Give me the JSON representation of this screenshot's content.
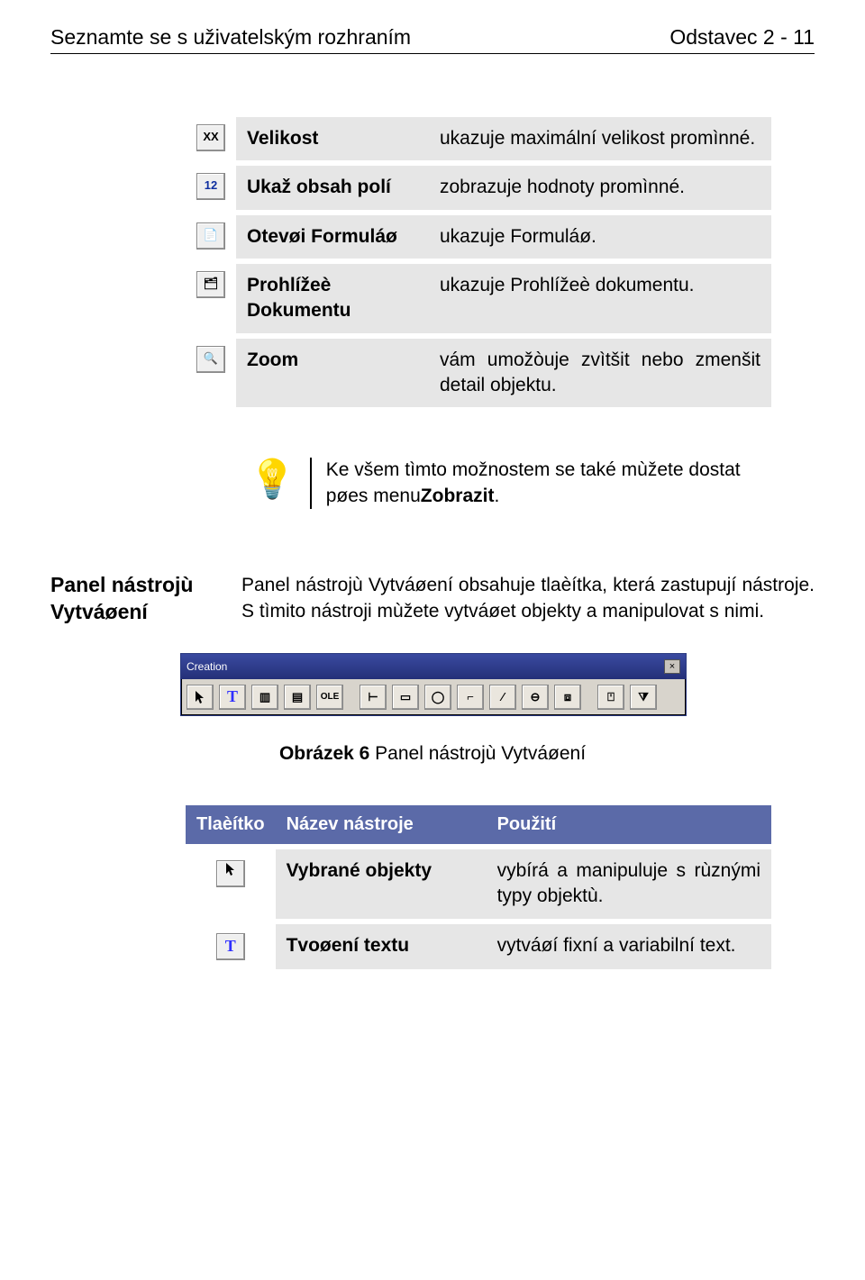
{
  "header": {
    "left": "Seznamte se s uživatelským rozhraním",
    "right": "Odstavec 2 - 11"
  },
  "table1": [
    {
      "icon": "xx-icon",
      "iconText": "XX",
      "name": "Velikost",
      "desc": "ukazuje maximální velikost promìnné."
    },
    {
      "icon": "number-icon",
      "iconText": "12",
      "name": "Ukaž obsah polí",
      "desc": "zobrazuje hodnoty promìnné."
    },
    {
      "icon": "form-icon",
      "iconText": "📄",
      "name": "Otevøi Formuláø",
      "desc": "ukazuje Formuláø."
    },
    {
      "icon": "tree-icon",
      "iconText": "🗂",
      "name": "Prohlížeè Dokumentu",
      "desc": "ukazuje Prohlížeè dokumentu."
    },
    {
      "icon": "zoom-icon",
      "iconText": "🔍",
      "name": "Zoom",
      "desc": "vám umožòuje zvìtšit nebo zmenšit detail objektu."
    }
  ],
  "tip": {
    "part1": "Ke všem tìmto možnostem se také mùžete dostat pøes menu",
    "bold": "Zobrazit",
    "part2": "."
  },
  "section": {
    "label": "Panel nástrojù Vytváøení",
    "body": "Panel nástrojù Vytváøení obsahuje tlaèítka, která zastupují nástroje. S tìmito nástroji mùžete vytváøet objekty a manipulovat s nimi."
  },
  "toolbar": {
    "title": "Creation",
    "buttons": [
      "▲",
      "T",
      "▥",
      "▤",
      "OLE",
      "⊢",
      "▭",
      "◯",
      "⌐",
      "∕",
      "⊖",
      "⧈",
      "⍞",
      "⧩"
    ]
  },
  "caption": {
    "bold": "Obrázek 6",
    "rest": " Panel nástrojù Vytváøení"
  },
  "table2": {
    "headers": {
      "h1": "Tlaèítko",
      "h2": "Název nástroje",
      "h3": "Použití"
    },
    "rows": [
      {
        "icon": "pointer-icon",
        "iconText": "▲",
        "name": "Vybrané objekty",
        "desc": "vybírá a manipuluje s rùznými typy objektù."
      },
      {
        "icon": "text-icon",
        "iconText": "T",
        "name": "Tvoøení textu",
        "desc": "vytváøí fixní a variabilní text."
      }
    ]
  }
}
